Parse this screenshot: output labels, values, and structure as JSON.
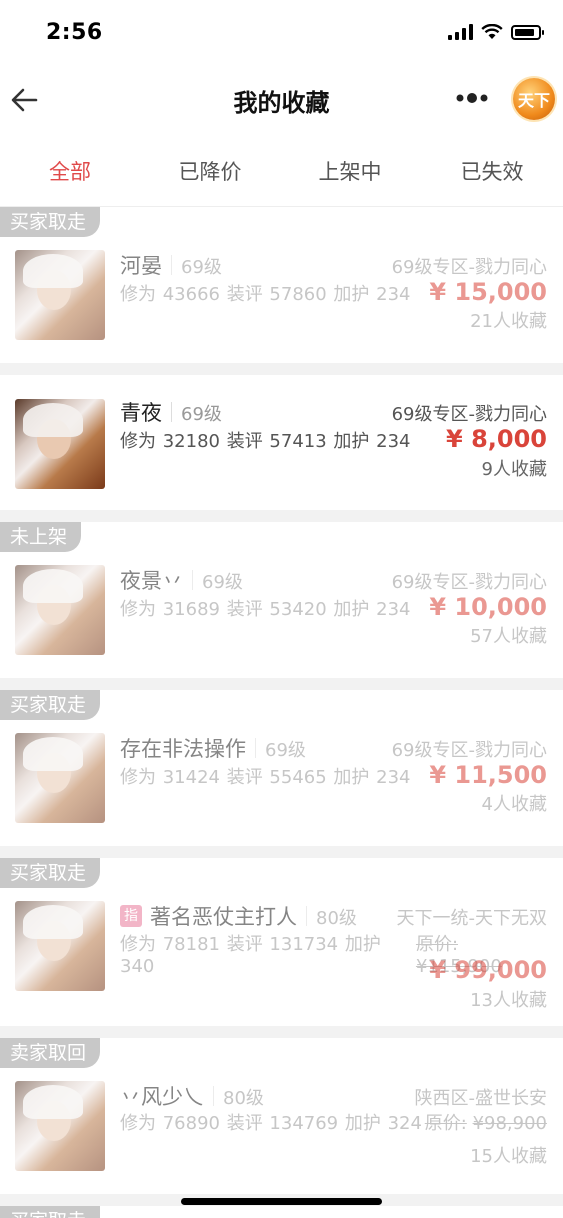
{
  "status": {
    "time": "2:56"
  },
  "nav": {
    "title": "我的收藏",
    "logo_text": "天下"
  },
  "tabs": [
    {
      "label": "全部",
      "active": true
    },
    {
      "label": "已降价",
      "active": false
    },
    {
      "label": "上架中",
      "active": false
    },
    {
      "label": "已失效",
      "active": false
    }
  ],
  "items": [
    {
      "badge": "买家取走",
      "name": "河晏",
      "level": "69级",
      "server": "69级专区-戮力同心",
      "stats": "修为 43666  装评 57860  加护 234",
      "price": "¥ 15,000",
      "favorites": "21人收藏",
      "dimmed": true
    },
    {
      "badge": "",
      "name": "青夜",
      "level": "69级",
      "server": "69级专区-戮力同心",
      "stats": "修为 32180  装评 57413  加护 234",
      "price": "¥ 8,000",
      "favorites": "9人收藏",
      "dimmed": false
    },
    {
      "badge": "未上架",
      "name": "夜景丷",
      "level": "69级",
      "server": "69级专区-戮力同心",
      "stats": "修为 31689  装评 53420  加护 234",
      "price": "¥ 10,000",
      "favorites": "57人收藏",
      "dimmed": true
    },
    {
      "badge": "买家取走",
      "name": "存在非法操作",
      "level": "69级",
      "server": "69级专区-戮力同心",
      "stats": "修为 31424  装评 55465  加护 234",
      "price": "¥ 11,500",
      "favorites": "4人收藏",
      "dimmed": true
    },
    {
      "badge": "买家取走",
      "tag": "指",
      "name": "著名恶仗主打人",
      "level": "80级",
      "server": "天下一统-天下无双",
      "stats": "修为 78181  装评 131734  加护 340",
      "original_price_label": "原价:",
      "original_price": "¥115,900",
      "price": "¥ 99,000",
      "favorites": "13人收藏",
      "dimmed": true
    },
    {
      "badge": "卖家取回",
      "name": "丷风少乀",
      "level": "80级",
      "server": "陕西区-盛世长安",
      "stats": "修为 76890  装评 134769  加护 324",
      "original_price_label": "原价:",
      "original_price": "¥98,900",
      "favorites": "15人收藏",
      "dimmed": true
    },
    {
      "badge": "买家取走"
    }
  ]
}
